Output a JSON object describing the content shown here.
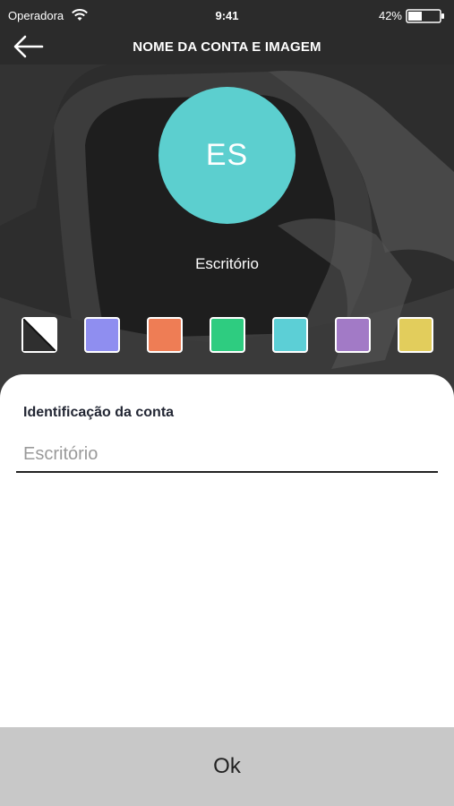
{
  "status_bar": {
    "carrier": "Operadora",
    "time": "9:41",
    "battery": "42%"
  },
  "header": {
    "title": "NOME DA CONTA E IMAGEM",
    "back_icon": "arrow-left-icon"
  },
  "avatar": {
    "initials": "ES",
    "color": "#5ccfcf",
    "name": "Escritório"
  },
  "swatches": [
    {
      "name": "none",
      "color": "#ffffff"
    },
    {
      "name": "periwinkle",
      "color": "#8f8ef0"
    },
    {
      "name": "orange",
      "color": "#ee7d55"
    },
    {
      "name": "green",
      "color": "#2ecc80"
    },
    {
      "name": "cyan",
      "color": "#5ccfd6"
    },
    {
      "name": "purple",
      "color": "#a27ac6"
    },
    {
      "name": "yellow",
      "color": "#e2cd5c"
    }
  ],
  "form": {
    "label": "Identificação da conta",
    "placeholder": "Escritório",
    "value": ""
  },
  "ok_button": {
    "label": "Ok"
  }
}
